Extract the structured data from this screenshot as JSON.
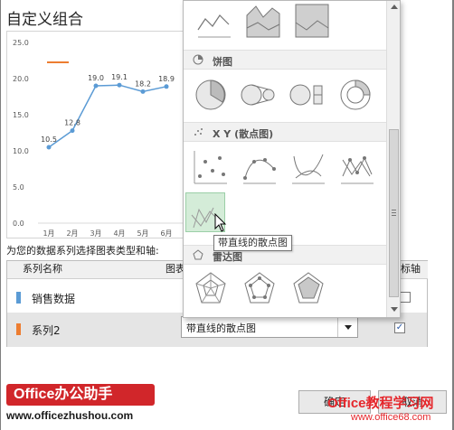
{
  "dialog": {
    "title": "自定义组合",
    "subtitle": "为您的数据系列选择图表类型和轴:"
  },
  "table": {
    "col_series_name": "系列名称",
    "col_chart_type": "图表",
    "col_secondary_axis": "标轴",
    "rows": [
      {
        "name": "销售数据",
        "color": "#5b9bd5"
      },
      {
        "name": "系列2",
        "color": "#ed7d31",
        "chart_type": "带直线的散点图",
        "secondary_axis": "✓"
      }
    ]
  },
  "gallery": {
    "sections": [
      {
        "label": "饼图",
        "icon": "pie-icon"
      },
      {
        "label": "X Y (散点图)",
        "icon": "scatter-icon"
      },
      {
        "label": "雷达图",
        "icon": "radar-icon"
      }
    ],
    "tooltip": "带直线的散点图"
  },
  "buttons": {
    "ok": "确定",
    "cancel": "取消"
  },
  "logo": {
    "brand": "Office办公助手",
    "url": "www.officezhushou.com"
  },
  "watermark": {
    "top": "Office教程学习网",
    "bottom": "www.office68.com"
  },
  "colors": {
    "series1": "#5b9bd5",
    "series2": "#ed7d31",
    "logo_red": "#d1262a",
    "hover_green": "#d4ecd8"
  },
  "chart_data": {
    "type": "line",
    "categories": [
      "1月",
      "2月",
      "3月",
      "4月",
      "5月",
      "6月"
    ],
    "series": [
      {
        "values": [
          10.5,
          12.8,
          19.0,
          19.1,
          18.2,
          18.9
        ],
        "labels": [
          "10.5",
          "12.8",
          "19.0",
          "19.1",
          "18.2",
          "18.9"
        ]
      }
    ],
    "ylim": [
      0,
      25
    ],
    "yticks": [
      "0.0",
      "5.0",
      "10.0",
      "15.0",
      "20.0",
      "25.0"
    ],
    "grid": false
  }
}
